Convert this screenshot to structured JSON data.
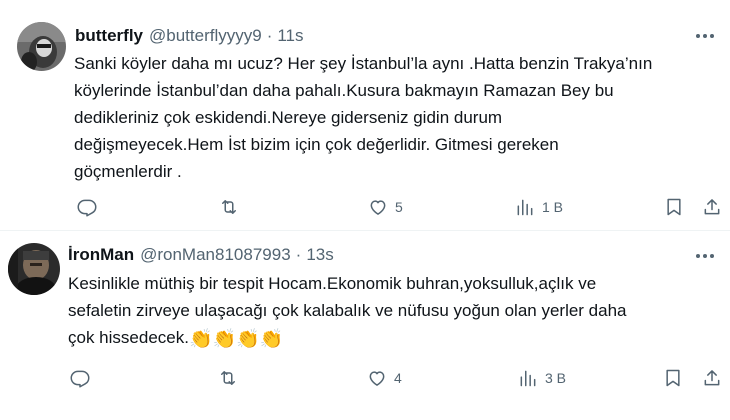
{
  "tweets": [
    {
      "display_name": "butterfly",
      "handle": "@butterflyyyy9",
      "separator": "·",
      "time": "11s",
      "text": "Sanki köyler daha mı ucuz? Her şey İstanbul’la aynı .Hatta benzin Trakya’nın\nköylerinde İstanbul’dan daha pahalı.Kusura bakmayın Ramazan Bey bu\ndedikleriniz çok eskidendi.Nereye giderseniz gidin durum\ndeğişmeyecek.Hem İst bizim için çok değerlidir. Gitmesi gereken\ngöçmenlerdir .",
      "emoji": "",
      "replies": "",
      "retweets": "",
      "likes": "5",
      "views": "1 B"
    },
    {
      "display_name": "İronMan",
      "handle": "@ronMan81087993",
      "separator": "·",
      "time": "13s",
      "text": "Kesinlikle müthiş bir tespit Hocam.Ekonomik buhran,yoksulluk,açlık ve\nsefaletin zirveye ulaşacağı çok kalabalık ve nüfusu yoğun olan yerler daha\nçok hissedecek.",
      "emoji": "👏👏👏👏",
      "replies": "",
      "retweets": "",
      "likes": "4",
      "views": "3 B"
    }
  ],
  "colors": {
    "text": "#0f1419",
    "muted": "#536471",
    "divider": "#eff3f4"
  },
  "icons": [
    "more-icon",
    "reply-icon",
    "retweet-icon",
    "like-icon",
    "views-icon",
    "bookmark-icon",
    "share-icon"
  ]
}
